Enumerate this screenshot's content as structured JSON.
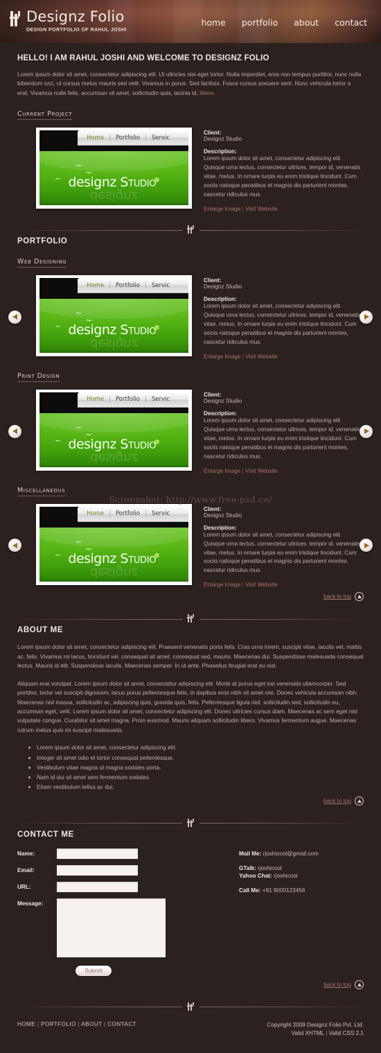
{
  "header": {
    "logo_title": "Designz Folio",
    "logo_sub": "DESIGN PORTFOLIO OF RAHUL JOSHI",
    "nav": [
      {
        "label": "home"
      },
      {
        "label": "portfolio"
      },
      {
        "label": "about"
      },
      {
        "label": "contact"
      }
    ]
  },
  "intro": {
    "heading": "HELLO! I AM RAHUL JOSHI AND WELCOME TO DESIGNZ FOLIO",
    "body": "Lorem ipsum dolor sit amet, consectetur adipiscing elit. Ut ultricies nisi eget tortor. Nulla imperdiet, eros non tempus porttitor, nunc nulla bibendum orci, ut cursus metus mauris sed velit. Vivamus in purus. Sed facilisis. Fusce cursus posuere sem. Nunc vehicula tortor a erat. Vivamus nulla felis, accumsan sit amet, sollicitudin quis, lacinia id, ",
    "link": "libero",
    "body_end": "."
  },
  "sections": {
    "current_project": "Current Project",
    "portfolio": "PORTFOLIO",
    "web_designing": "Web Designing",
    "print_design": "Print Design",
    "miscellaneous": "Miscellaneous",
    "about_me": "ABOUT ME",
    "contact_me": "CONTACT ME"
  },
  "thumb": {
    "menu": [
      "Home",
      "Portfolio",
      "Servic"
    ],
    "separator": "|",
    "logo_lower": "designz ",
    "logo_caps": "Studio",
    "star": "✻"
  },
  "project_meta": {
    "client_label": "Client:",
    "client_value": "Designz Studio",
    "description_label": "Description:",
    "description_value": "Lorem ipsum dolor sit amet, consectetur adipiscing elit. Quisque urna lectus, consectetur ultrices, tempor id, venenatis vitae, metus. In ornare turpis eu enim tristique tincidunt. Cum sociis natoque penatibus et magnis dis parturient montes, nascetur ridiculus mus.",
    "link_enlarge": "Enlarge Image",
    "link_pipe": "|",
    "link_visit": "Visit Website"
  },
  "carousel": {
    "prev_icon": "left-arrow-icon",
    "next_icon": "right-arrow-icon"
  },
  "back_to_top": {
    "label": "back to top",
    "icon": "up-arrow-icon"
  },
  "about": {
    "p1": "Lorem ipsum dolor sit amet, consectetur adipiscing elit. Praesent venenatis porta felis. Cras urna lorem, suscipit vitae, iaculis vel, mattis ac, felis. Vivamus mi lacus, tincidunt vel, consequat sit amet, consequat sed, mauris. Maecenas dui. Suspendisse malesuada consequat lectus. Mauris id elit. Suspendisse iaculis. Maecenas semper. In ut ante. Phasellus feugiat erat eu nisl.",
    "p2": "Aliquam erat volutpat. Lorem ipsum dolor sit amet, consectetur adipiscing elit. Morbi at purus eget est venenatis ullamcorper. Sed porttitor, tortor vel suscipit dignissim, lacus purus pellentesque felis, in dapibus eros nibh sit amet nisi. Donec vehicula accumsan nibh. Maecenas nisl massa, sollicitudin ac, adipiscing quis, gravida quis, felis. Pellentesque ligula nisl, sollicitudin sed, sollicitudin eu, accumsan eget, velit. Lorem ipsum dolor sit amet, consectetur adipiscing elit. Donec ultricies cursus diam. Maecenas ac sem eget nisl vulputate congue. Curabitur sit amet magna. Proin euismod. Mauris aliquam sollicitudin libero. Vivamus fermentum augue. Maecenas rutrum metus quis mi suscipit malesuada.",
    "bullets": [
      "Lorem ipsum dolor sit amet, consectetur adipiscing elit.",
      "Integer sit amet odio et tortor consequat pellentesque.",
      "Vestibulum vitae magna ut magna sodales porta.",
      "Nam id dui sit amet sem fermentum sodales.",
      "Etiam vestibulum tellus ac dui."
    ]
  },
  "contact": {
    "fields": [
      {
        "label": "Name:",
        "value": "",
        "placeholder": ""
      },
      {
        "label": "Email:",
        "value": "",
        "placeholder": ""
      },
      {
        "label": "URL:",
        "value": "",
        "placeholder": ""
      }
    ],
    "message_label": "Message:",
    "message_value": "",
    "submit_label": "Submit",
    "mail_label": "Mail Me:",
    "mail_value": "rjoshicool@gmail.com",
    "gtalk_label": "GTalk:",
    "gtalk_value": "rjoshicool",
    "yahoo_label": "Yahoo Chat:",
    "yahoo_value": "rjoshicool",
    "call_label": "Call Me:",
    "call_value": "+91 9000123456"
  },
  "footer": {
    "nav": [
      "HOME",
      "PORTFOLIO",
      "ABOUT",
      "CONTACT"
    ],
    "sep": "|",
    "copyright": "Copyright 2009 Designz Folio Pvt. Ltd.",
    "valid_xhtml": "Valid XHTML",
    "valid_css": "Valid CSS 2.1"
  },
  "watermark": "Screenshot: http://www.free-psd.co/",
  "colors": {
    "page_bg": "#2b211e",
    "accent_link": "#a9756b",
    "green": "#54b312",
    "header_brown": "#8a4f3e"
  }
}
